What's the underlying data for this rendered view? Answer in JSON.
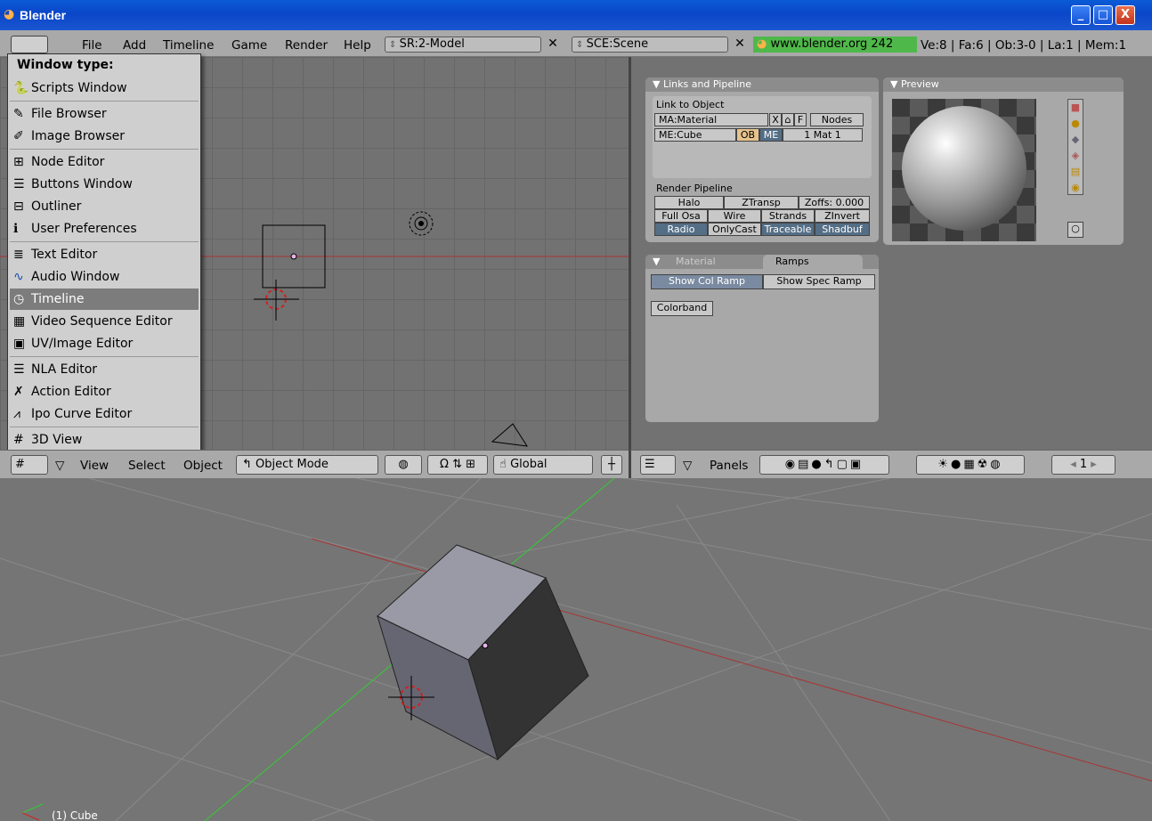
{
  "app": {
    "title": "Blender"
  },
  "window_controls": {
    "minimize": "_",
    "maximize": "□",
    "close": "X"
  },
  "menubar": {
    "items": [
      "File",
      "Add",
      "Timeline",
      "Game",
      "Render",
      "Help"
    ],
    "screen_field": "SR:2-Model",
    "scene_field": "SCE:Scene",
    "link": "www.blender.org 242",
    "stats": "Ve:8 | Fa:6 | Ob:3-0 | La:1  | Mem:1"
  },
  "dropdown": {
    "title": "Window type:",
    "items": [
      {
        "label": "Scripts Window",
        "icon": "python-icon"
      },
      {
        "label": "File Browser",
        "icon": "file-browser-icon"
      },
      {
        "label": "Image Browser",
        "icon": "image-browser-icon"
      },
      {
        "label": "Node Editor",
        "icon": "node-editor-icon"
      },
      {
        "label": "Buttons Window",
        "icon": "buttons-window-icon"
      },
      {
        "label": "Outliner",
        "icon": "outliner-icon"
      },
      {
        "label": "User Preferences",
        "icon": "user-preferences-icon"
      },
      {
        "label": "Text Editor",
        "icon": "text-editor-icon"
      },
      {
        "label": "Audio Window",
        "icon": "audio-window-icon"
      },
      {
        "label": "Timeline",
        "icon": "timeline-icon",
        "selected": true
      },
      {
        "label": "Video Sequence Editor",
        "icon": "video-sequence-icon"
      },
      {
        "label": "UV/Image Editor",
        "icon": "uv-image-icon"
      },
      {
        "label": "NLA Editor",
        "icon": "nla-editor-icon"
      },
      {
        "label": "Action Editor",
        "icon": "action-editor-icon"
      },
      {
        "label": "Ipo Curve Editor",
        "icon": "ipo-curve-icon"
      },
      {
        "label": "3D View",
        "icon": "3d-view-icon"
      }
    ]
  },
  "links_panel": {
    "header": "Links and Pipeline",
    "link_to_object": "Link to Object",
    "material_field": "MA:Material",
    "x_btn": "X",
    "f_btn": "F",
    "nodes_btn": "Nodes",
    "mesh_field": "ME:Cube",
    "ob_btn": "OB",
    "me_btn": "ME",
    "mat_field": "1 Mat 1",
    "render_pipeline": "Render Pipeline",
    "pipeline_buttons": [
      [
        "Halo",
        "ZTransp",
        "Zoffs: 0.000"
      ],
      [
        "Full Osa",
        "Wire",
        "Strands",
        "ZInvert"
      ],
      [
        "Radio",
        "OnlyCast",
        "Traceable",
        "Shadbuf"
      ]
    ]
  },
  "preview_panel": {
    "header": "Preview"
  },
  "material_panel": {
    "tab_material": "Material",
    "tab_ramps": "Ramps",
    "show_col_ramp": "Show Col Ramp",
    "show_spec_ramp": "Show Spec Ramp",
    "colorband": "Colorband"
  },
  "view3d_header": {
    "menus": [
      "View",
      "Select",
      "Object"
    ],
    "mode": "Object Mode",
    "orientation": "Global"
  },
  "buttons_header": {
    "panels": "Panels",
    "frame": "1"
  },
  "bottom_view": {
    "object_label": "(1) Cube"
  }
}
